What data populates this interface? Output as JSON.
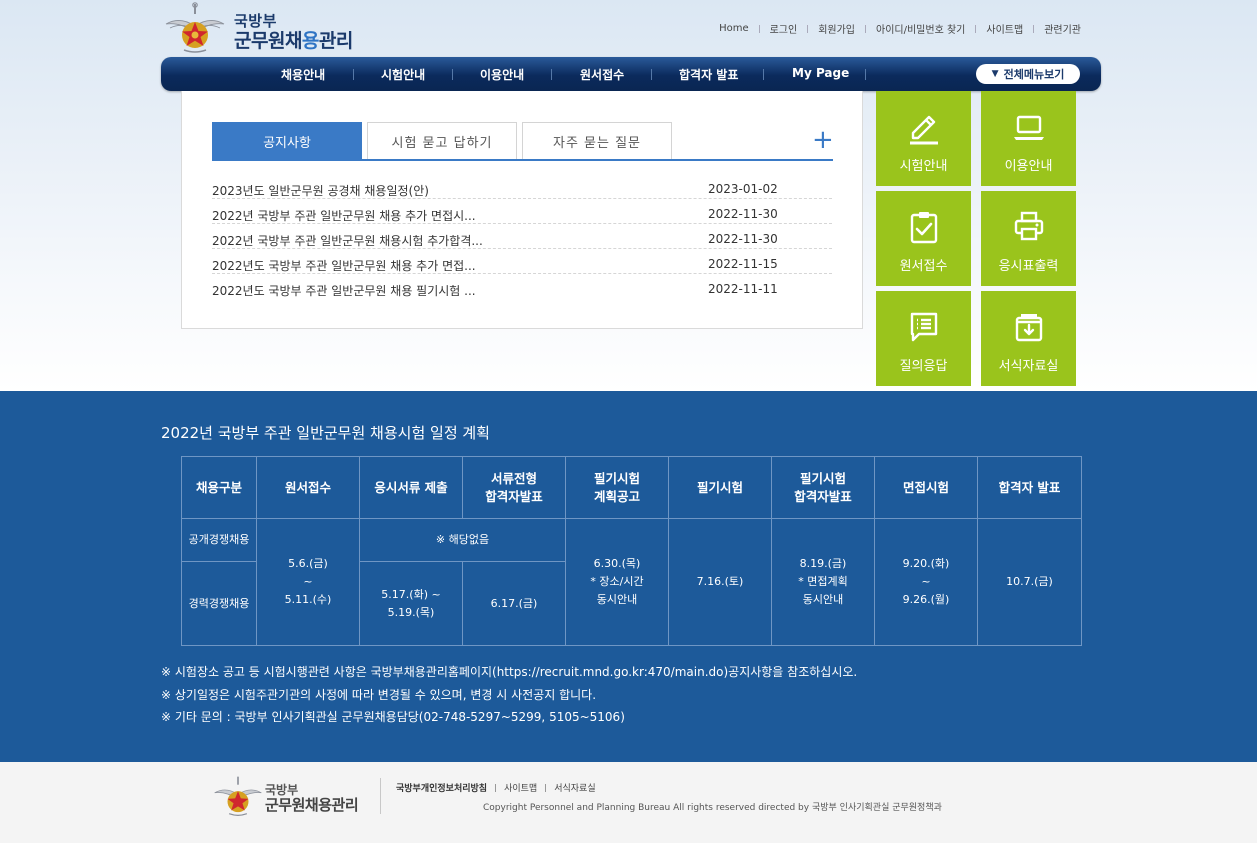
{
  "header": {
    "logo_top": "국방부",
    "logo_main_a": "군무원채",
    "logo_main_b": "용",
    "logo_main_c": "관리",
    "util_links": [
      "Home",
      "로그인",
      "회원가입",
      "아이디/비밀번호 찾기",
      "사이트맵",
      "관련기관"
    ]
  },
  "gnb": {
    "items": [
      "채용안내",
      "시험안내",
      "이용안내",
      "원서접수",
      "합격자 발표",
      "My Page"
    ],
    "all_menu": "전체메뉴보기"
  },
  "notice": {
    "tabs": [
      "공지사항",
      "시험 묻고 답하기",
      "자주 묻는 질문"
    ],
    "more": "+",
    "rows": [
      {
        "title": "2023년도 일반군무원 공경채 채용일정(안)",
        "date": "2023-01-02"
      },
      {
        "title": "2022년 국방부 주관 일반군무원 채용 추가 면접시...",
        "date": "2022-11-30"
      },
      {
        "title": "2022년 국방부 주관 일반군무원 채용시험 추가합격...",
        "date": "2022-11-30"
      },
      {
        "title": "2022년도 국방부 주관 일반군무원 채용 추가 면접...",
        "date": "2022-11-15"
      },
      {
        "title": "2022년도 국방부 주관 일반군무원 채용 필기시험 ...",
        "date": "2022-11-11"
      }
    ]
  },
  "quick": {
    "tiles": [
      {
        "label": "시험안내",
        "icon": "pencil-icon"
      },
      {
        "label": "이용안내",
        "icon": "laptop-icon"
      },
      {
        "label": "원서접수",
        "icon": "clipboard-check-icon"
      },
      {
        "label": "응시표출력",
        "icon": "printer-icon"
      },
      {
        "label": "질의응답",
        "icon": "message-list-icon"
      },
      {
        "label": "서식자료실",
        "icon": "download-box-icon"
      }
    ],
    "tile_color": "#9ac41c"
  },
  "schedule": {
    "title": "2022년 국방부 주관 일반군무원 채용시험 일정 계획",
    "headers": [
      "채용구분",
      "원서접수",
      "응시서류 제출",
      "서류전형|합격자발표",
      "필기시험|계획공고",
      "필기시험",
      "필기시험|합격자발표",
      "면접시험",
      "합격자 발표"
    ],
    "row1_type": "공개경쟁채용",
    "row2_type": "경력경쟁채용",
    "application": "5.6.(금)|~|5.11.(수)",
    "row1_docs_na": "※ 해당없음",
    "row2_docs": "5.17.(화) ~|5.19.(목)",
    "row2_doc_result": "6.17.(금)",
    "written_plan": "6.30.(목)|* 장소/시간|동시안내",
    "written_exam": "7.16.(토)",
    "written_result": "8.19.(금)|* 면접계획|동시안내",
    "interview": "9.20.(화)|~|9.26.(월)",
    "final": "10.7.(금)",
    "notes": [
      "※ 시험장소 공고 등 시험시행관련 사항은 국방부채용관리홈페이지(https://recruit.mnd.go.kr:470/main.do)공지사항을 참조하십시오.",
      "※ 상기일정은 시험주관기관의 사정에 따라 변경될 수 있으며, 변경 시 사전공지 합니다.",
      "※ 기타 문의 : 국방부 인사기획관실 군무원채용담당(02-748-5297~5299, 5105~5106)"
    ],
    "bg_color": "#1d5a9a"
  },
  "footer": {
    "logo_top": "국방부",
    "logo_main_a": "군무원채",
    "logo_main_b": "용",
    "logo_main_c": "관리",
    "links": [
      "국방부개인정보처리방침",
      "사이트맵",
      "서식자료실"
    ],
    "copyright": "Copyright Personnel and Planning Bureau All rights reserved directed by 국방부 인사기획관실 군무원정책과"
  }
}
